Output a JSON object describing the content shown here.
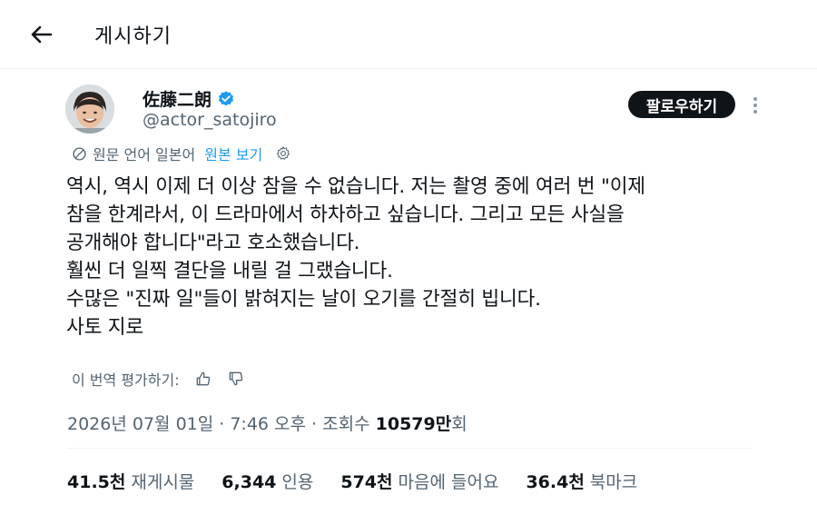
{
  "header": {
    "title": "게시하기",
    "back_icon": "arrow-left-icon"
  },
  "author": {
    "name": "佐藤二朗",
    "handle": "@actor_satojiro",
    "verified": true,
    "verified_color": "#1d9bf0"
  },
  "actions": {
    "follow_label": "팔로우하기",
    "more_icon": "more-vertical-icon"
  },
  "translation": {
    "source_label": "원문 언어 일본어",
    "show_original_label": "원본 보기",
    "settings_icon": "gear-icon"
  },
  "tweet": {
    "lines": [
      "역시, 역시 이제 더 이상 참을 수 없습니다. 저는 촬영 중에 여러 번 \"이제",
      "참을 한계라서, 이 드라마에서 하차하고 싶습니다. 그리고 모든 사실을",
      "공개해야 합니다\"라고 호소했습니다.",
      "훨씬 더 일찍 결단을 내릴 걸 그랬습니다.",
      "수많은 \"진짜 일\"들이 밝혀지는 날이 오기를 간절히 빕니다.",
      "사토 지로"
    ]
  },
  "rate_translation": {
    "label": "이 번역 평가하기:",
    "up_icon": "thumbs-up-icon",
    "down_icon": "thumbs-down-icon"
  },
  "meta": {
    "timestamp": "2026년 07월 01일 · 7:46 오후 · 조회수 ",
    "views_number": "10579만",
    "views_suffix": "회"
  },
  "stats": [
    {
      "value": "41.5천",
      "label": "재게시물"
    },
    {
      "value": "6,344",
      "label": "인용"
    },
    {
      "value": "574천",
      "label": "마음에 들어요"
    },
    {
      "value": "36.4천",
      "label": "북마크"
    }
  ],
  "colors": {
    "accent": "#1d9bf0",
    "text": "#0f1419",
    "secondary": "#536471"
  }
}
